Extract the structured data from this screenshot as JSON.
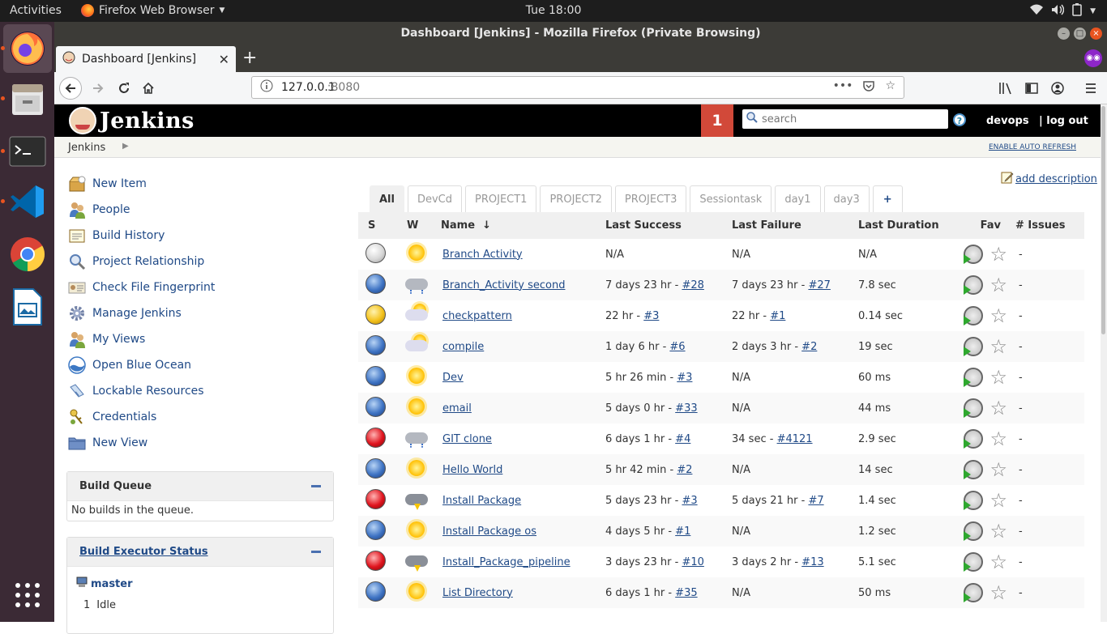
{
  "topbar": {
    "activities": "Activities",
    "app_menu": "Firefox Web Browser",
    "clock": "Tue 18:00"
  },
  "window": {
    "title": "Dashboard [Jenkins] - Mozilla Firefox (Private Browsing)"
  },
  "browser": {
    "tab_title": "Dashboard [Jenkins]",
    "new_tab_label": "+",
    "url_host": "127.0.0.1",
    "url_port": ":8080"
  },
  "jenkins": {
    "logo_text": "Jenkins",
    "notification_count": "1",
    "search_placeholder": "search",
    "help_label": "?",
    "user": "devops",
    "logout": "| log out",
    "breadcrumb": "Jenkins",
    "auto_refresh": "ENABLE AUTO REFRESH",
    "add_description": "add description"
  },
  "sidebar": {
    "tasks": [
      {
        "label": "New Item",
        "icon": "new-item-icon"
      },
      {
        "label": "People",
        "icon": "people-icon"
      },
      {
        "label": "Build History",
        "icon": "build-history-icon"
      },
      {
        "label": "Project Relationship",
        "icon": "magnifier-icon"
      },
      {
        "label": "Check File Fingerprint",
        "icon": "fingerprint-icon"
      },
      {
        "label": "Manage Jenkins",
        "icon": "gear-icon"
      },
      {
        "label": "My Views",
        "icon": "people-icon"
      },
      {
        "label": "Open Blue Ocean",
        "icon": "blue-ocean-icon"
      },
      {
        "label": "Lockable Resources",
        "icon": "lock-icon"
      },
      {
        "label": "Credentials",
        "icon": "keys-icon"
      },
      {
        "label": "New View",
        "icon": "folder-icon"
      }
    ],
    "build_queue": {
      "title": "Build Queue",
      "empty": "No builds in the queue."
    },
    "executor_status": {
      "title": "Build Executor Status",
      "node": "master",
      "executors": [
        {
          "num": "1",
          "state": "Idle"
        }
      ]
    }
  },
  "views": {
    "tabs": [
      "All",
      "DevCd",
      "PROJECT1",
      "PROJECT2",
      "PROJECT3",
      "Sessiontask",
      "day1",
      "day3"
    ],
    "active": "All",
    "add_label": "+"
  },
  "table": {
    "headers": {
      "s": "S",
      "w": "W",
      "name": "Name",
      "sort": "↓",
      "last_success": "Last Success",
      "last_failure": "Last Failure",
      "last_duration": "Last Duration",
      "fav": "Fav",
      "issues": "# Issues"
    },
    "rows": [
      {
        "status": "grey",
        "weather": "sunny",
        "name": "Branch Activity",
        "succ": "N/A",
        "succ_link": "",
        "fail": "N/A",
        "fail_link": "",
        "dur": "N/A",
        "issues": "-"
      },
      {
        "status": "blue",
        "weather": "rain",
        "name": "Branch_Activity second",
        "succ": "7 days 23 hr - ",
        "succ_link": "#28",
        "fail": "7 days 23 hr - ",
        "fail_link": "#27",
        "dur": "7.8 sec",
        "issues": "-"
      },
      {
        "status": "yellow",
        "weather": "partly",
        "name": "checkpattern",
        "succ": "22 hr - ",
        "succ_link": "#3",
        "fail": "22 hr - ",
        "fail_link": "#1",
        "dur": "0.14 sec",
        "issues": "-"
      },
      {
        "status": "blue",
        "weather": "partly",
        "name": "compile",
        "succ": "1 day 6 hr - ",
        "succ_link": "#6",
        "fail": "2 days 3 hr - ",
        "fail_link": "#2",
        "dur": "19 sec",
        "issues": "-"
      },
      {
        "status": "blue",
        "weather": "sunny",
        "name": "Dev",
        "succ": "5 hr 26 min - ",
        "succ_link": "#3",
        "fail": "N/A",
        "fail_link": "",
        "dur": "60 ms",
        "issues": "-"
      },
      {
        "status": "blue",
        "weather": "sunny",
        "name": "email",
        "succ": "5 days 0 hr - ",
        "succ_link": "#33",
        "fail": "N/A",
        "fail_link": "",
        "dur": "44 ms",
        "issues": "-"
      },
      {
        "status": "red",
        "weather": "rain",
        "name": "GIT clone",
        "succ": "6 days 1 hr - ",
        "succ_link": "#4",
        "fail": "34 sec - ",
        "fail_link": "#4121",
        "dur": "2.9 sec",
        "issues": "-"
      },
      {
        "status": "blue",
        "weather": "sunny",
        "name": "Hello World",
        "succ": "5 hr 42 min - ",
        "succ_link": "#2",
        "fail": "N/A",
        "fail_link": "",
        "dur": "14 sec",
        "issues": "-"
      },
      {
        "status": "red",
        "weather": "storm",
        "name": "Install Package",
        "succ": "5 days 23 hr - ",
        "succ_link": "#3",
        "fail": "5 days 21 hr - ",
        "fail_link": "#7",
        "dur": "1.4 sec",
        "issues": "-"
      },
      {
        "status": "blue",
        "weather": "sunny",
        "name": "Install Package os",
        "succ": "4 days 5 hr - ",
        "succ_link": "#1",
        "fail": "N/A",
        "fail_link": "",
        "dur": "1.2 sec",
        "issues": "-"
      },
      {
        "status": "red",
        "weather": "storm",
        "name": "Install_Package_pipeline",
        "succ": "3 days 23 hr - ",
        "succ_link": "#10",
        "fail": "3 days 2 hr - ",
        "fail_link": "#13",
        "dur": "5.1 sec",
        "issues": "-"
      },
      {
        "status": "blue",
        "weather": "sunny",
        "name": "List Directory",
        "succ": "6 days 1 hr - ",
        "succ_link": "#35",
        "fail": "N/A",
        "fail_link": "",
        "dur": "50 ms",
        "issues": "-"
      }
    ]
  }
}
